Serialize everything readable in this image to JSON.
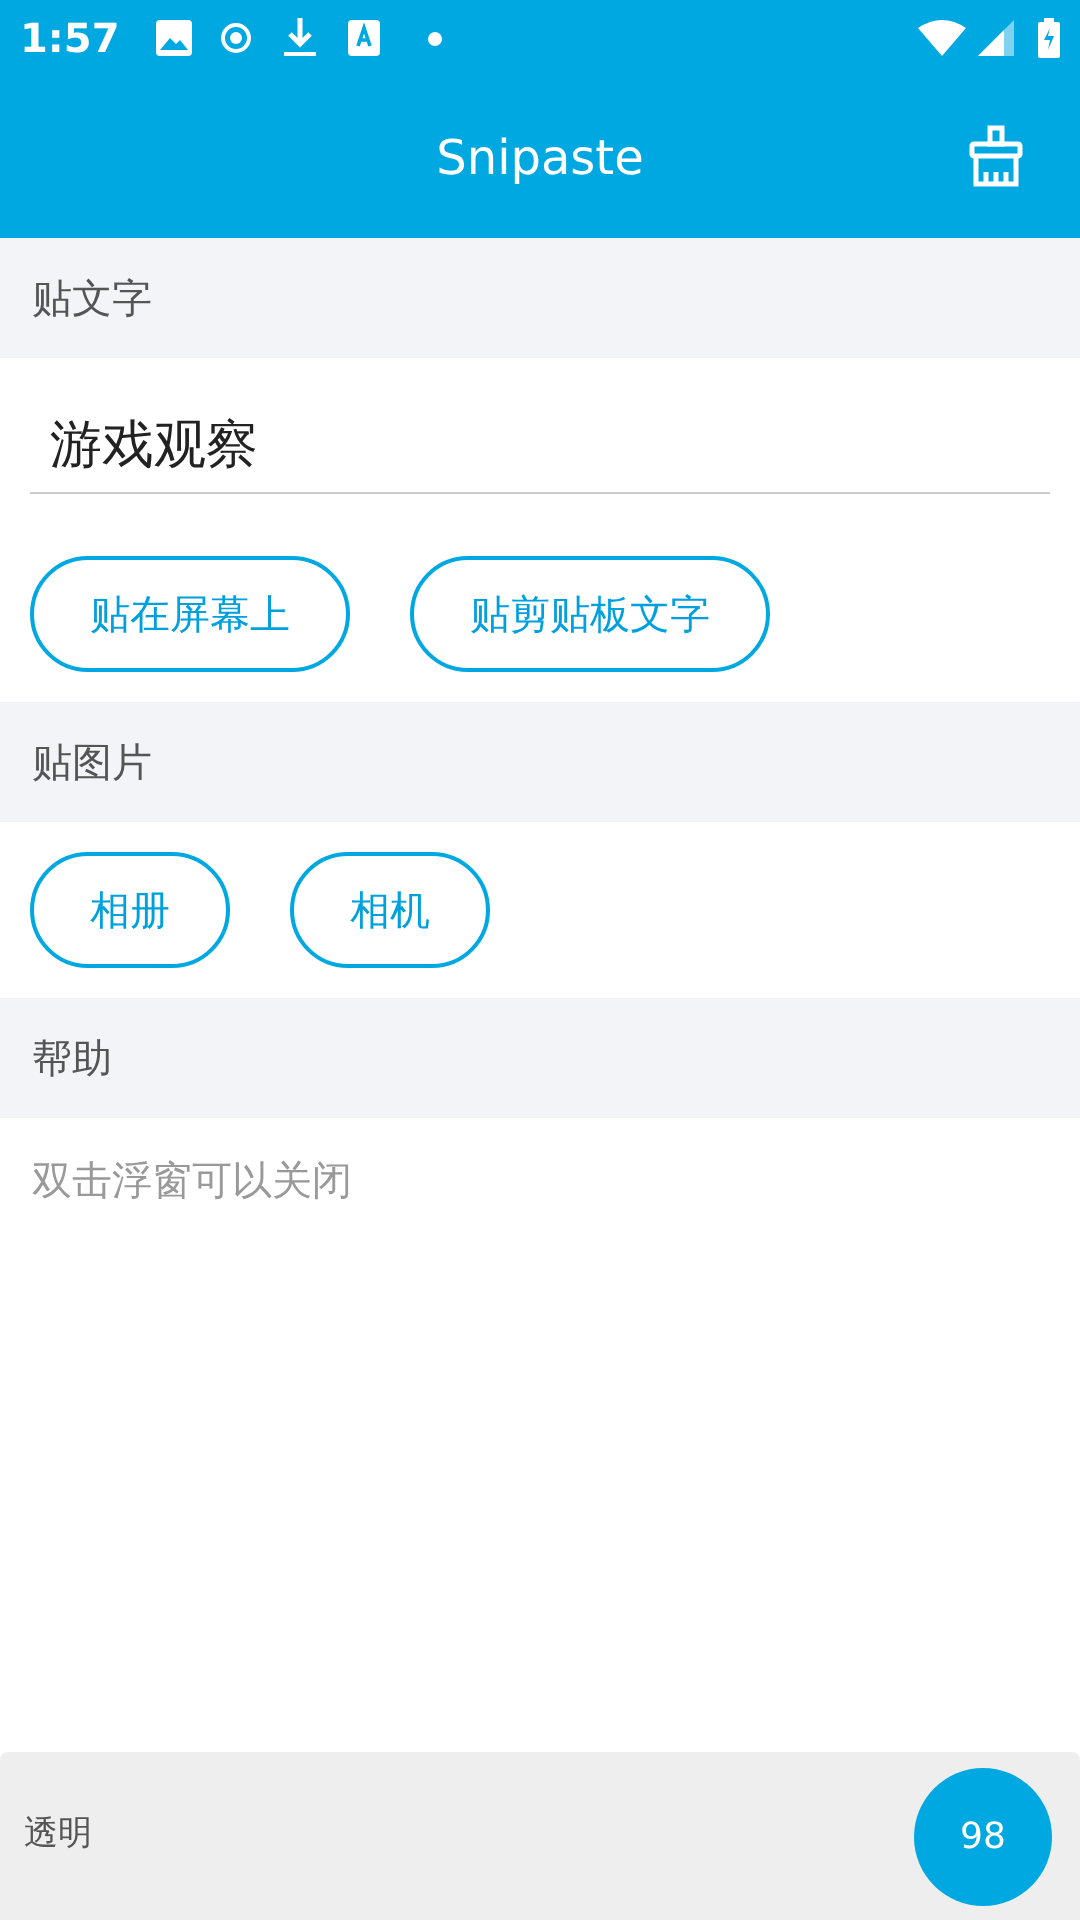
{
  "status_bar": {
    "time": "1:57"
  },
  "app_bar": {
    "title": "Snipaste"
  },
  "text_section": {
    "header": "贴文字",
    "value": "游戏观察",
    "buttons": [
      "贴在屏幕上",
      "贴剪贴板文字"
    ]
  },
  "image_section": {
    "header": "贴图片",
    "buttons": [
      "相册",
      "相机"
    ]
  },
  "help_section": {
    "header": "帮助",
    "text": "双击浮窗可以关闭"
  },
  "opacity_bar": {
    "label": "透明",
    "value": "98"
  }
}
